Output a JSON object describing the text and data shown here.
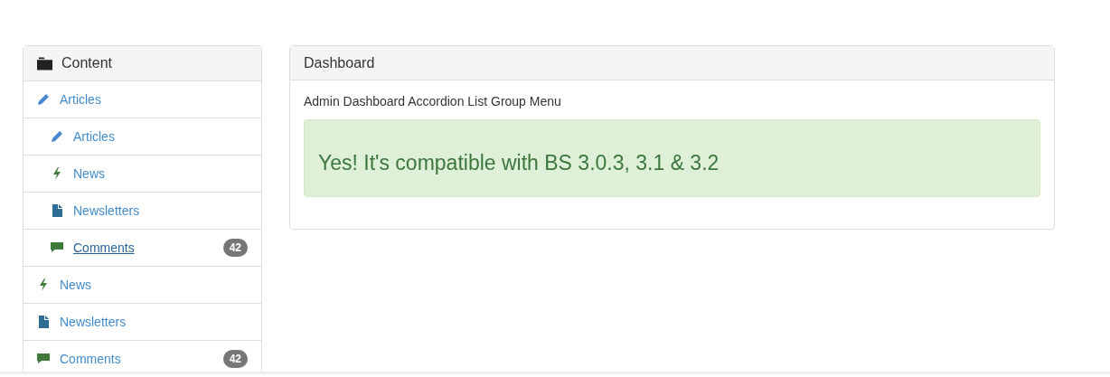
{
  "sidebar": {
    "title": "Content",
    "items": [
      {
        "label": "Articles",
        "kind": "article",
        "underlined": false,
        "children": [
          {
            "label": "Articles",
            "kind": "article",
            "underlined": false
          },
          {
            "label": "News",
            "kind": "news",
            "underlined": false
          },
          {
            "label": "Newsletters",
            "kind": "newsletter",
            "underlined": false
          },
          {
            "label": "Comments",
            "kind": "comment",
            "underlined": true,
            "badge": "42"
          }
        ]
      },
      {
        "label": "News",
        "kind": "news",
        "underlined": false
      },
      {
        "label": "Newsletters",
        "kind": "newsletter",
        "underlined": false
      },
      {
        "label": "Comments",
        "kind": "comment",
        "underlined": false,
        "badge": "42"
      }
    ]
  },
  "panel": {
    "title": "Dashboard",
    "text": "Admin Dashboard Accordion List Group Menu",
    "alert": "Yes! It's compatible with BS 3.0.3, 3.1 & 3.2"
  }
}
